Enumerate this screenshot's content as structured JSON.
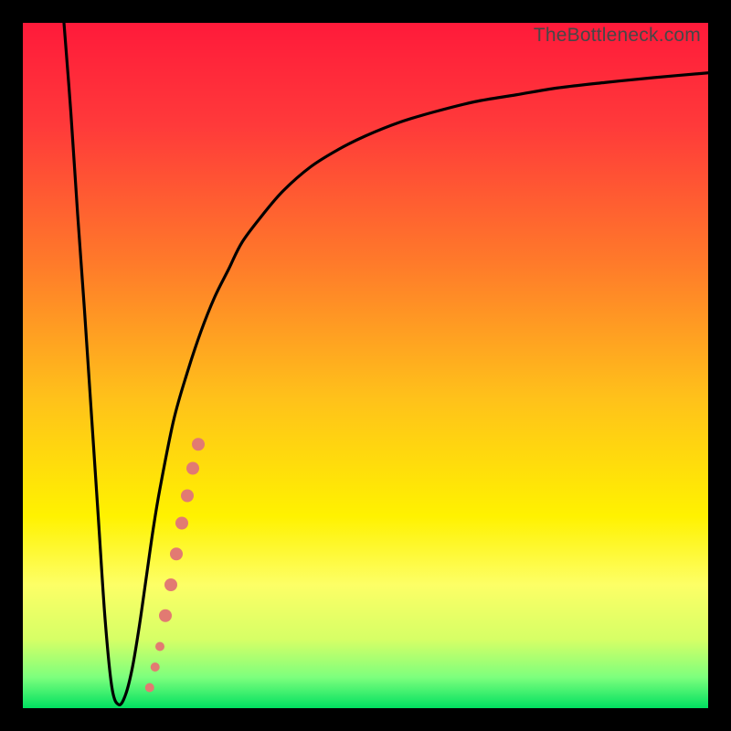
{
  "watermark": "TheBottleneck.com",
  "chart_data": {
    "type": "line",
    "title": "",
    "xlabel": "",
    "ylabel": "",
    "xlim": [
      0,
      100
    ],
    "ylim": [
      0,
      100
    ],
    "grid": false,
    "legend": false,
    "background_gradient_stops": [
      {
        "pos": 0.0,
        "color": "#ff1a3a"
      },
      {
        "pos": 0.15,
        "color": "#ff3a3a"
      },
      {
        "pos": 0.35,
        "color": "#ff7a2a"
      },
      {
        "pos": 0.55,
        "color": "#ffc21a"
      },
      {
        "pos": 0.72,
        "color": "#fff200"
      },
      {
        "pos": 0.82,
        "color": "#fdff66"
      },
      {
        "pos": 0.9,
        "color": "#d6ff66"
      },
      {
        "pos": 0.955,
        "color": "#7dff7d"
      },
      {
        "pos": 1.0,
        "color": "#00e060"
      }
    ],
    "series": [
      {
        "name": "bottleneck-curve",
        "color": "#000000",
        "x": [
          6,
          7,
          8,
          9,
          10,
          11,
          12,
          13,
          14,
          15,
          16,
          17,
          18,
          19,
          20,
          22,
          24,
          26,
          28,
          30,
          32,
          35,
          38,
          42,
          46,
          50,
          55,
          60,
          66,
          72,
          78,
          85,
          92,
          100
        ],
        "y": [
          100,
          87,
          72,
          58,
          43,
          28,
          13,
          3,
          0.5,
          2,
          6,
          12,
          19,
          26,
          32,
          42,
          49,
          55,
          60,
          64,
          68,
          72,
          75.5,
          79,
          81.5,
          83.5,
          85.5,
          87,
          88.5,
          89.5,
          90.5,
          91.3,
          92,
          92.7
        ]
      }
    ],
    "highlight_segment": {
      "name": "marked-points",
      "color": "#e27a72",
      "points": [
        {
          "x": 18.5,
          "y": 3.0,
          "r": 5
        },
        {
          "x": 19.3,
          "y": 6.0,
          "r": 5
        },
        {
          "x": 20.0,
          "y": 9.0,
          "r": 5
        },
        {
          "x": 20.8,
          "y": 13.5,
          "r": 7
        },
        {
          "x": 21.6,
          "y": 18.0,
          "r": 7
        },
        {
          "x": 22.4,
          "y": 22.5,
          "r": 7
        },
        {
          "x": 23.2,
          "y": 27.0,
          "r": 7
        },
        {
          "x": 24.0,
          "y": 31.0,
          "r": 7
        },
        {
          "x": 24.8,
          "y": 35.0,
          "r": 7
        },
        {
          "x": 25.6,
          "y": 38.5,
          "r": 7
        }
      ]
    }
  }
}
